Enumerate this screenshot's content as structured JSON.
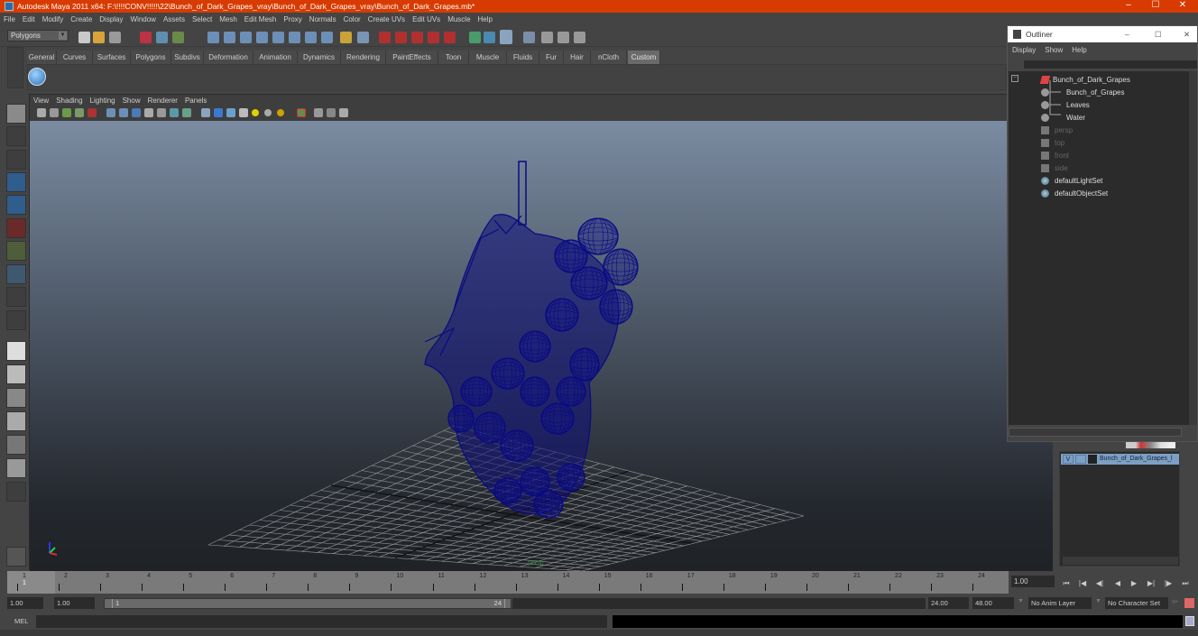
{
  "window": {
    "title": "Autodesk Maya 2011 x64: F:\\!!!!CONV!!!!!\\22\\Bunch_of_Dark_Grapes_vray\\Bunch_of_Dark_Grapes_vray\\Bunch_of_Dark_Grapes.mb*",
    "minimize": "–",
    "maximize": "☐",
    "close": "✕",
    "accent_color": "#d83b01"
  },
  "menubar": [
    "File",
    "Edit",
    "Modify",
    "Create",
    "Display",
    "Window",
    "Assets",
    "Select",
    "Mesh",
    "Edit Mesh",
    "Proxy",
    "Normals",
    "Color",
    "Create UVs",
    "Edit UVs",
    "Muscle",
    "Help"
  ],
  "statusline": {
    "mode": "Polygons"
  },
  "shelf": {
    "tabs": [
      "General",
      "Curves",
      "Surfaces",
      "Polygons",
      "Subdivs",
      "Deformation",
      "Animation",
      "Dynamics",
      "Rendering",
      "PaintEffects",
      "Toon",
      "Muscle",
      "Fluids",
      "Fur",
      "Hair",
      "nCloth",
      "Custom"
    ],
    "active_tab": "Custom"
  },
  "viewport": {
    "menu": [
      "View",
      "Shading",
      "Lighting",
      "Show",
      "Renderer",
      "Panels"
    ],
    "camera_label": "persp",
    "wireframe_color": "#0a0a80"
  },
  "outliner": {
    "title": "Outliner",
    "menu": [
      "Display",
      "Show",
      "Help"
    ],
    "items": [
      {
        "label": "Bunch_of_Dark_Grapes",
        "type": "group",
        "dim": false
      },
      {
        "label": "Bunch_of_Grapes",
        "type": "mesh",
        "dim": false
      },
      {
        "label": "Leaves",
        "type": "mesh",
        "dim": false
      },
      {
        "label": "Water",
        "type": "mesh",
        "dim": false
      },
      {
        "label": "persp",
        "type": "camera",
        "dim": true
      },
      {
        "label": "top",
        "type": "camera",
        "dim": true
      },
      {
        "label": "front",
        "type": "camera",
        "dim": true
      },
      {
        "label": "side",
        "type": "camera",
        "dim": true
      },
      {
        "label": "defaultLightSet",
        "type": "set",
        "dim": false
      },
      {
        "label": "defaultObjectSet",
        "type": "set",
        "dim": false
      }
    ]
  },
  "layers": {
    "rows": [
      {
        "visible": "V",
        "name": "Bunch_of_Dark_Grapes_l"
      }
    ]
  },
  "timeline": {
    "ticks": [
      "1",
      "2",
      "3",
      "4",
      "5",
      "6",
      "7",
      "8",
      "9",
      "10",
      "11",
      "12",
      "13",
      "14",
      "15",
      "16",
      "17",
      "18",
      "19",
      "20",
      "21",
      "22",
      "23",
      "24"
    ],
    "current_frame_marker": "1",
    "current_frame": "1.00"
  },
  "playback": {
    "buttons": [
      "⏮",
      "|◀",
      "◀|",
      "◀",
      "▶",
      "▶|",
      "|▶",
      "⏭"
    ]
  },
  "range": {
    "start": "1.00",
    "playback_start": "1.00",
    "slider_start": "1",
    "slider_end": "24",
    "playback_end": "24.00",
    "end": "48.00",
    "anim_layer": "No Anim Layer",
    "character_set": "No Character Set"
  },
  "command": {
    "label": "MEL"
  }
}
